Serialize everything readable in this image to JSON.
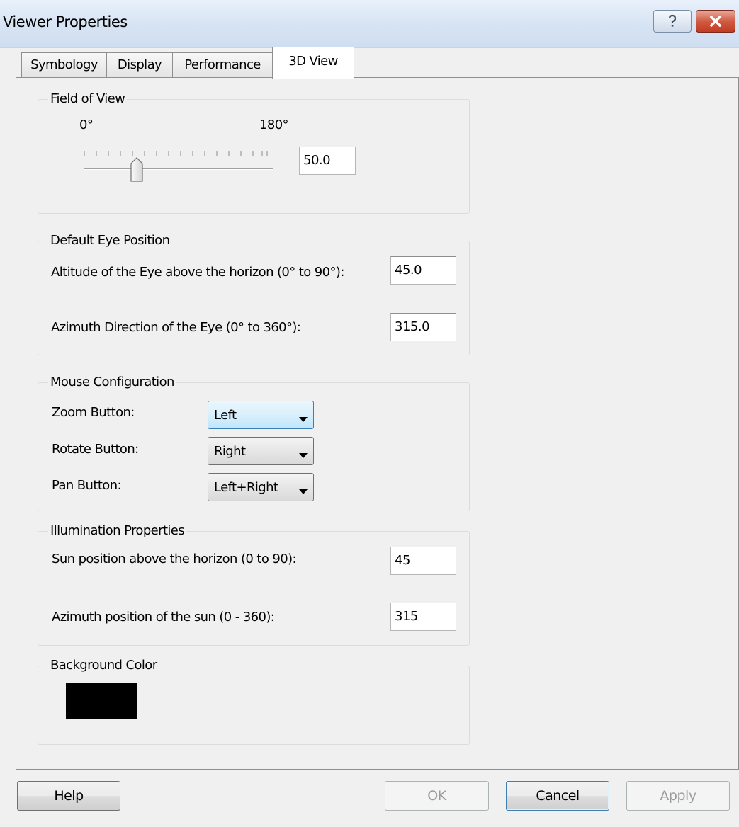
{
  "window": {
    "title": "Viewer Properties"
  },
  "tabs": [
    {
      "label": "Symbology"
    },
    {
      "label": "Display"
    },
    {
      "label": "Performance"
    },
    {
      "label": "3D View"
    }
  ],
  "active_tab": "3D View",
  "field_of_view": {
    "group_label": "Field of View",
    "min_label": "0°",
    "max_label": "180°",
    "value": "50.0",
    "slider_level_fraction": 0.278
  },
  "default_eye_position": {
    "group_label": "Default Eye Position",
    "altitude_label": "Altitude of the Eye above the horizon (0° to 90°):",
    "altitude_value": "45.0",
    "azimuth_label": "Azimuth Direction of the Eye (0° to 360°):",
    "azimuth_value": "315.0"
  },
  "mouse_configuration": {
    "group_label": "Mouse Configuration",
    "zoom_label": "Zoom Button:",
    "zoom_value": "Left",
    "rotate_label": "Rotate Button:",
    "rotate_value": "Right",
    "pan_label": "Pan Button:",
    "pan_value": "Left+Right"
  },
  "illumination": {
    "group_label": "Illumination Properties",
    "sun_altitude_label": "Sun position above the horizon (0 to 90):",
    "sun_altitude_value": "45",
    "sun_azimuth_label": "Azimuth position of the sun (0 - 360):",
    "sun_azimuth_value": "315"
  },
  "background": {
    "group_label": "Background Color",
    "color": "#000000"
  },
  "buttons": {
    "help": "Help",
    "ok": "OK",
    "cancel": "Cancel",
    "apply": "Apply"
  },
  "icons": {
    "help_caption": "question-icon",
    "close_caption": "close-icon",
    "dropdown": "chevron-down-icon"
  }
}
